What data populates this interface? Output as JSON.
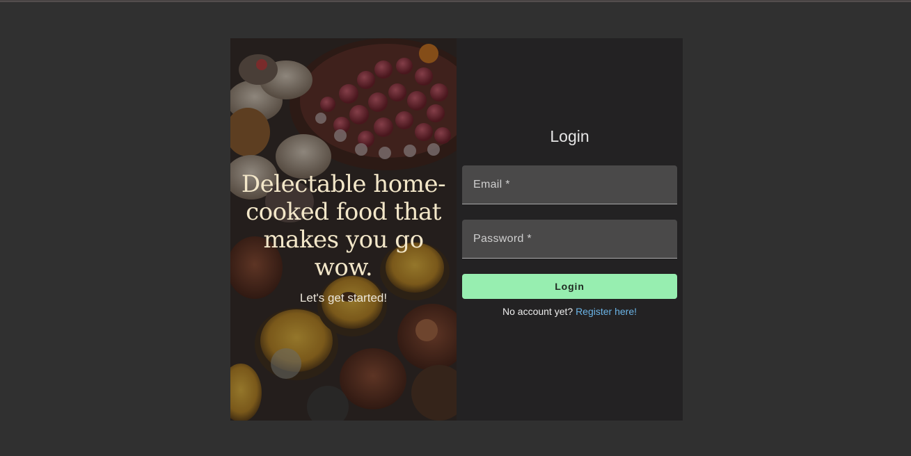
{
  "hero": {
    "headline": "Delectable home-cooked food that makes you go wow.",
    "tagline": "Let's get started!"
  },
  "login": {
    "title": "Login",
    "email_placeholder": "Email *",
    "password_placeholder": "Password *",
    "submit_label": "Login",
    "register_prompt": "No account yet?",
    "register_link": "Register here!"
  },
  "colors": {
    "page_background": "#303030",
    "panel_background": "#232223",
    "field_background": "#4a4949",
    "button_accent": "#97eeb0",
    "link": "#6bb4e6",
    "headline": "#f3e7c9"
  }
}
